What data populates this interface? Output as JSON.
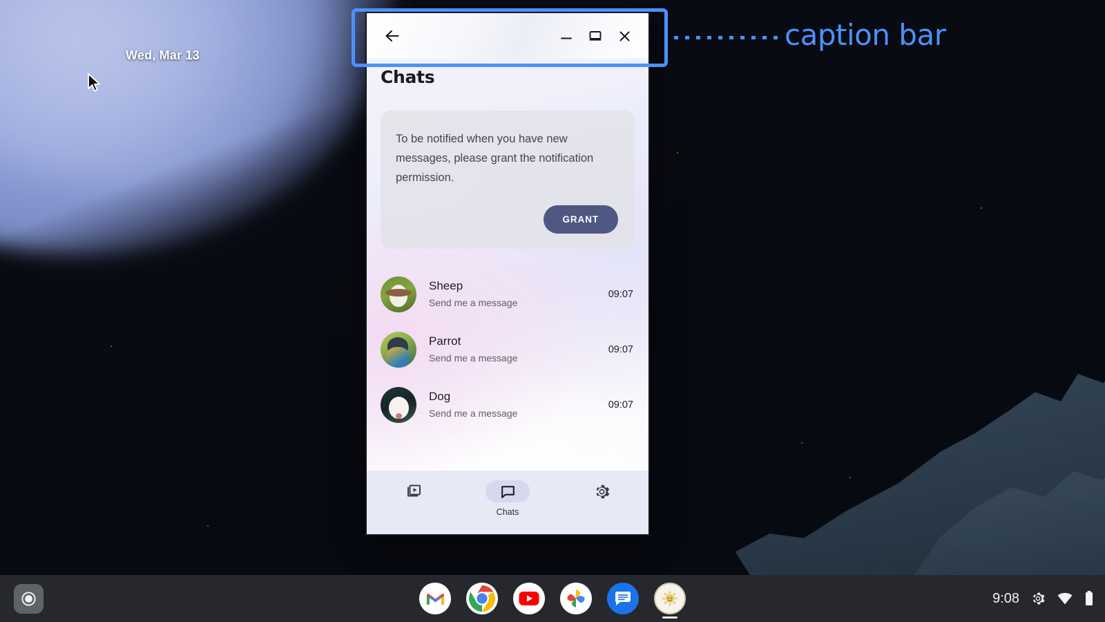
{
  "desktop": {
    "date_text": "Wed, Mar 13",
    "cursor_icon": "arrow-cursor-icon",
    "wallpaper_colors": {
      "dark": "#090b12",
      "glow": "#97a6dd",
      "mountain": "#344757"
    }
  },
  "annotation": {
    "label": "caption bar",
    "color": "#4d90fe",
    "connector": "dotted-line"
  },
  "window": {
    "caption_bar": {
      "back_label": "back-arrow",
      "buttons": [
        {
          "name": "minimize-button",
          "icon": "minimize-icon",
          "tooltip": "Minimize"
        },
        {
          "name": "restore-button",
          "icon": "restore-window-icon",
          "tooltip": "Restore"
        },
        {
          "name": "close-button",
          "icon": "close-icon",
          "tooltip": "Close"
        }
      ]
    },
    "app": {
      "title": "Chats",
      "permission": {
        "message": "To be notified when you have new messages, please grant the notification permission.",
        "button_label": "GRANT",
        "button_color": "#4e5882"
      },
      "chats": [
        {
          "name": "Sheep",
          "preview": "Send me a message",
          "time": "09:07",
          "avatar": "sheep-avatar"
        },
        {
          "name": "Parrot",
          "preview": "Send me a message",
          "time": "09:07",
          "avatar": "parrot-avatar"
        },
        {
          "name": "Dog",
          "preview": "Send me a message",
          "time": "09:07",
          "avatar": "dog-avatar"
        }
      ],
      "bottom_nav": [
        {
          "label": "",
          "icon": "slideshow-icon",
          "active": false,
          "name": "nav-item-media"
        },
        {
          "label": "Chats",
          "icon": "chat-bubble-icon",
          "active": true,
          "name": "nav-item-chats"
        },
        {
          "label": "",
          "icon": "gear-icon",
          "active": false,
          "name": "nav-item-settings"
        }
      ]
    }
  },
  "shelf": {
    "launcher_icon": "launcher-circle-icon",
    "apps": [
      {
        "name": "gmail-app-icon",
        "label": "Gmail",
        "active": false
      },
      {
        "name": "chrome-app-icon",
        "label": "Chrome",
        "active": false
      },
      {
        "name": "youtube-app-icon",
        "label": "YouTube",
        "active": false
      },
      {
        "name": "photos-app-icon",
        "label": "Google Photos",
        "active": false
      },
      {
        "name": "messages-app-icon",
        "label": "Messages",
        "active": false
      },
      {
        "name": "chat-demo-app-icon",
        "label": "Chat App",
        "active": true
      }
    ],
    "tray": {
      "time": "9:08",
      "icons": [
        "gear-icon",
        "wifi-icon",
        "battery-icon"
      ]
    }
  }
}
